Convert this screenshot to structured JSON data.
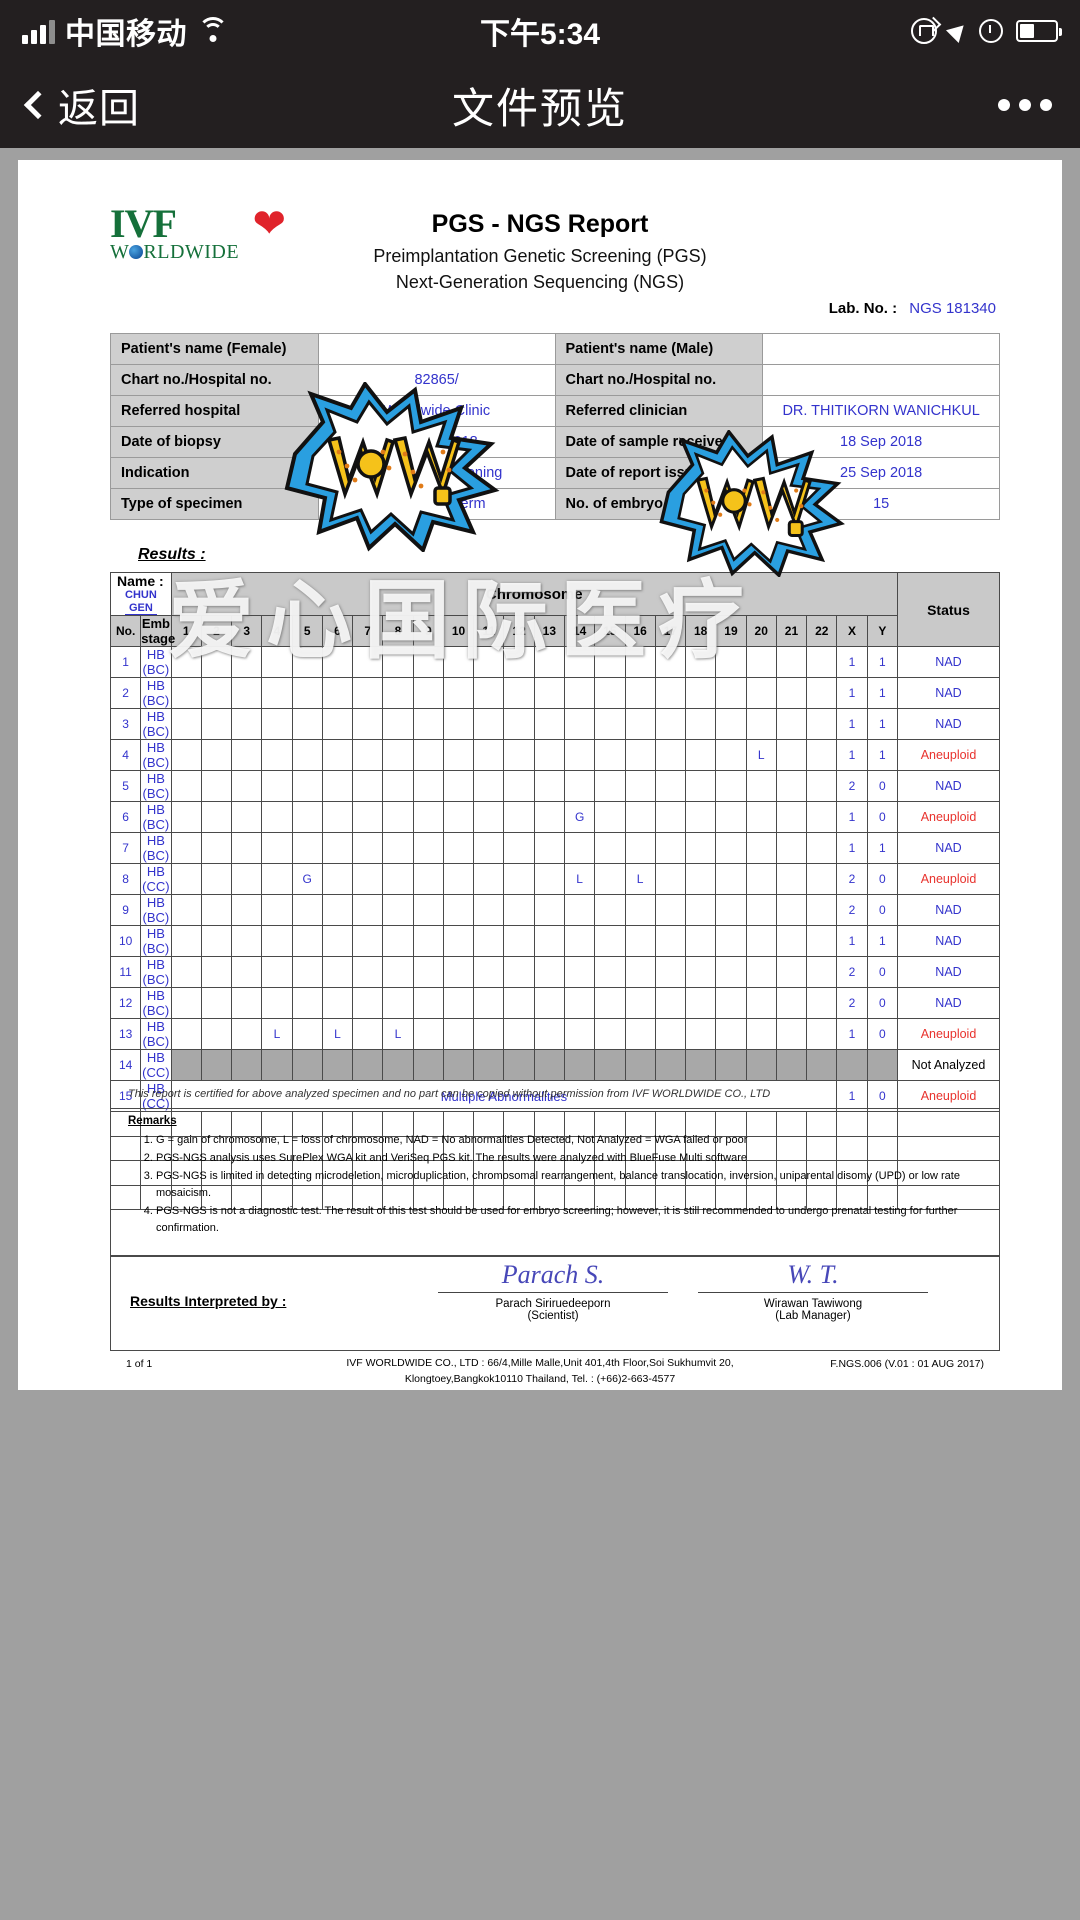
{
  "status_bar": {
    "carrier": "中国移动",
    "time": "下午5:34",
    "signal_icon": "signal-bars-icon",
    "wifi_icon": "wifi-icon",
    "lock_icon": "rotation-lock-icon",
    "location_icon": "location-arrow-icon",
    "alarm_icon": "alarm-clock-icon",
    "battery_icon": "battery-icon"
  },
  "nav": {
    "back_label": "返回",
    "title": "文件预览",
    "more_icon": "more-dots-icon"
  },
  "document": {
    "logo": {
      "line1": "IVF",
      "line2": "W RLDWIDE",
      "cupid_icon": "cupid-icon"
    },
    "title": "PGS - NGS Report",
    "subtitle1": "Preimplantation Genetic Screening (PGS)",
    "subtitle2": "Next-Generation Sequencing (NGS)",
    "lab_no_label": "Lab. No. :",
    "lab_no_value": "NGS 181340",
    "watermark": "爱心国际医疗",
    "sticker_text": "WOW!",
    "info_rows": [
      {
        "label_l": "Patient's name (Female)",
        "value_l": "",
        "label_r": "Patient's name (Male)",
        "value_r": ""
      },
      {
        "label_l": "Chart no./Hospital no.",
        "value_l": "82865/",
        "label_r": "Chart no./Hospital no.",
        "value_r": ""
      },
      {
        "label_l": "Referred hospital",
        "value_l": "Worldwide Clinic",
        "label_r": "Referred clinician",
        "value_r": "DR. THITIKORN WANICHKUL"
      },
      {
        "label_l": "Date of biopsy",
        "value_l": "17 Sep 2018",
        "label_r": "Date of sample received",
        "value_r": "18 Sep 2018"
      },
      {
        "label_l": "Indication",
        "value_l": "Aneuploid screening",
        "label_r": "Date of report issued",
        "value_r": "25 Sep 2018"
      },
      {
        "label_l": "Type of specimen",
        "value_l": "Trophectoderm",
        "label_r": "No. of embryo tested",
        "value_r": "15"
      }
    ],
    "results_label": "Results :",
    "results_table": {
      "name_label": "Name :",
      "name_value_line1": "CHUN",
      "name_value_line2": "GEN",
      "chromosome_header": "Chromosome",
      "status_header": "Status",
      "col_no": "No.",
      "col_emb": "Emb stage",
      "chromosomes": [
        "1",
        "2",
        "3",
        "4",
        "5",
        "6",
        "7",
        "8",
        "9",
        "10",
        "11",
        "12",
        "13",
        "14",
        "15",
        "16",
        "17",
        "18",
        "19",
        "20",
        "21",
        "22"
      ],
      "sex_cols": [
        "X",
        "Y"
      ],
      "rows": [
        {
          "no": "1",
          "emb": "HB (BC)",
          "marks": {},
          "x": "1",
          "y": "1",
          "status": "NAD",
          "status_kind": "nad"
        },
        {
          "no": "2",
          "emb": "HB (BC)",
          "marks": {},
          "x": "1",
          "y": "1",
          "status": "NAD",
          "status_kind": "nad"
        },
        {
          "no": "3",
          "emb": "HB (BC)",
          "marks": {},
          "x": "1",
          "y": "1",
          "status": "NAD",
          "status_kind": "nad"
        },
        {
          "no": "4",
          "emb": "HB (BC)",
          "marks": {
            "20": "L"
          },
          "x": "1",
          "y": "1",
          "status": "Aneuploid",
          "status_kind": "aneuploid"
        },
        {
          "no": "5",
          "emb": "HB (BC)",
          "marks": {},
          "x": "2",
          "y": "0",
          "status": "NAD",
          "status_kind": "nad"
        },
        {
          "no": "6",
          "emb": "HB (BC)",
          "marks": {
            "14": "G"
          },
          "x": "1",
          "y": "0",
          "status": "Aneuploid",
          "status_kind": "aneuploid"
        },
        {
          "no": "7",
          "emb": "HB (BC)",
          "marks": {},
          "x": "1",
          "y": "1",
          "status": "NAD",
          "status_kind": "nad"
        },
        {
          "no": "8",
          "emb": "HB (CC)",
          "marks": {
            "5": "G",
            "14": "L",
            "16": "L"
          },
          "x": "2",
          "y": "0",
          "status": "Aneuploid",
          "status_kind": "aneuploid"
        },
        {
          "no": "9",
          "emb": "HB (BC)",
          "marks": {},
          "x": "2",
          "y": "0",
          "status": "NAD",
          "status_kind": "nad"
        },
        {
          "no": "10",
          "emb": "HB (BC)",
          "marks": {},
          "x": "1",
          "y": "1",
          "status": "NAD",
          "status_kind": "nad"
        },
        {
          "no": "11",
          "emb": "HB (BC)",
          "marks": {},
          "x": "2",
          "y": "0",
          "status": "NAD",
          "status_kind": "nad"
        },
        {
          "no": "12",
          "emb": "HB (BC)",
          "marks": {},
          "x": "2",
          "y": "0",
          "status": "NAD",
          "status_kind": "nad"
        },
        {
          "no": "13",
          "emb": "HB (BC)",
          "marks": {
            "4": "L",
            "6": "L",
            "8": "L"
          },
          "x": "1",
          "y": "0",
          "status": "Aneuploid",
          "status_kind": "aneuploid"
        },
        {
          "no": "14",
          "emb": "HB (CC)",
          "greyed": true,
          "marks": {},
          "x": "",
          "y": "",
          "status": "Not Analyzed",
          "status_kind": "notanalyzed"
        },
        {
          "no": "15",
          "emb": "HB (CC)",
          "span_text": "Multiple Abnormalities",
          "marks": {},
          "x": "1",
          "y": "0",
          "status": "Aneuploid",
          "status_kind": "aneuploid"
        },
        {
          "no": "",
          "emb": "",
          "marks": {},
          "x": "",
          "y": "",
          "status": "",
          "status_kind": "none"
        },
        {
          "no": "",
          "emb": "",
          "marks": {},
          "x": "",
          "y": "",
          "status": "",
          "status_kind": "none"
        },
        {
          "no": "",
          "emb": "",
          "marks": {},
          "x": "",
          "y": "",
          "status": "",
          "status_kind": "none"
        },
        {
          "no": "",
          "emb": "",
          "marks": {},
          "x": "",
          "y": "",
          "status": "",
          "status_kind": "none"
        }
      ]
    },
    "certify_text": "This report is certified for above analyzed specimen and no part can be copied without permission from IVF WORLDWIDE CO., LTD",
    "remarks_title": "Remarks",
    "remarks": [
      "G = gain of chromosome, L = loss of chromosome, NAD = No abnormalities Detected, Not Analyzed = WGA failed or poor",
      "PGS-NGS analysis uses SurePlex WGA kit and VeriSeq PGS kit. The results were analyzed with BlueFuse Multi software",
      "PGS-NGS is limited in detecting microdeletion, microduplication, chromosomal rearrangement, balance translocation, inversion, uniparental disomy (UPD) or low rate mosaicism.",
      "PGS-NGS is not a diagnostic test. The result of this test should be used for embryo screening; however, it is still recommended to undergo prenatal testing for further confirmation."
    ],
    "interpreted_label": "Results Interpreted by :",
    "signatures": [
      {
        "ink": "Parach S.",
        "name": "Parach Siriruedeeporn",
        "role": "(Scientist)"
      },
      {
        "ink": "W. T.",
        "name": "Wirawan Tawiwong",
        "role": "(Lab Manager)"
      }
    ],
    "footer": {
      "page": "1 of 1",
      "address_line1": "IVF WORLDWIDE CO., LTD : 66/4,Mille Malle,Unit 401,4th Floor,Soi Sukhumvit 20,",
      "address_line2": "Klongtoey,Bangkok10110 Thailand, Tel. : (+66)2-663-4577",
      "doc_code": "F.NGS.006 (V.01 : 01 AUG 2017)"
    }
  },
  "colors": {
    "value_blue": "#3333cc",
    "aneuploid_red": "#e8322d",
    "header_grey": "#c9c9c9",
    "bar_dark": "#231f20"
  }
}
